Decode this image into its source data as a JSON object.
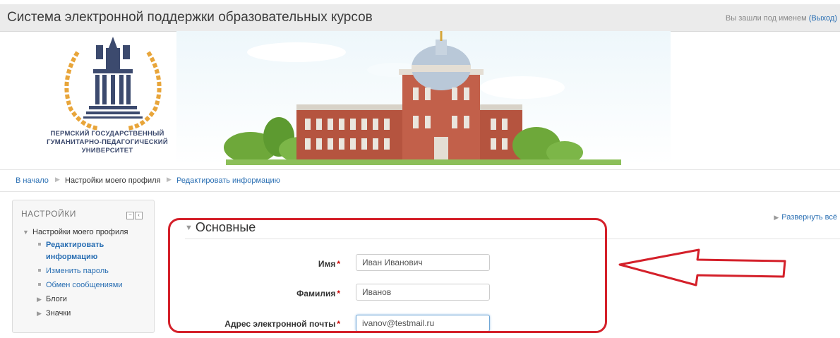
{
  "header": {
    "site_title": "Система электронной поддержки образовательных курсов",
    "login_prefix": "Вы зашли под именем",
    "logout_link": "(Выход)"
  },
  "logo": {
    "line1": "ПЕРМСКИЙ ГОСУДАРСТВЕННЫЙ",
    "line2": "ГУМАНИТАРНО-ПЕДАГОГИЧЕСКИЙ",
    "line3": "УНИВЕРСИТЕТ"
  },
  "breadcrumb": {
    "home": "В начало",
    "profile": "Настройки моего профиля",
    "current": "Редактировать информацию"
  },
  "settings_block": {
    "title": "НАСТРОЙКИ",
    "profile_node": "Настройки моего профиля",
    "items": [
      "Редактировать",
      "информацию",
      "Изменить пароль",
      "Обмен сообщениями"
    ],
    "blogs": "Блоги",
    "badges": "Значки"
  },
  "main": {
    "expand_all": "Развернуть всё",
    "section_title": "Основные",
    "fields": [
      {
        "label": "Имя",
        "value": "Иван Иванович"
      },
      {
        "label": "Фамилия",
        "value": "Иванов"
      },
      {
        "label": "Адрес электронной почты",
        "value": "ivanov@testmail.ru"
      }
    ]
  },
  "colors": {
    "link": "#2a6fb3",
    "annotation": "#d4202a",
    "required": "#cc0000"
  }
}
